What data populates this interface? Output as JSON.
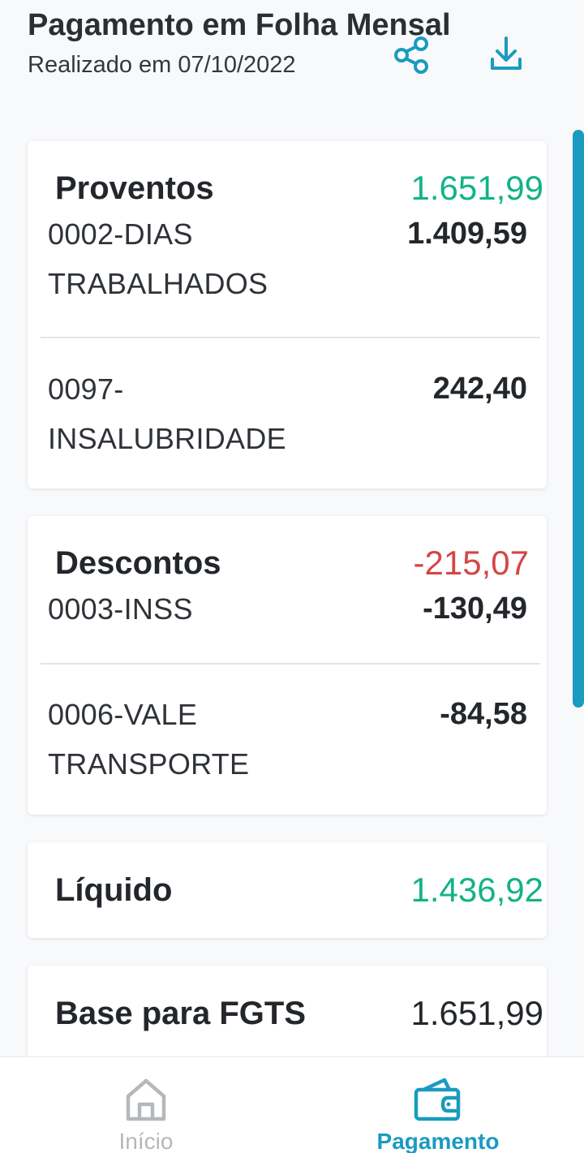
{
  "header": {
    "title": "Pagamento em Folha Mensal",
    "subtitle": "Realizado em 07/10/2022",
    "share_icon": "share-icon",
    "download_icon": "download-icon"
  },
  "colors": {
    "accent": "#1a9bbf",
    "positive": "#12b386",
    "negative": "#d64545"
  },
  "proventos": {
    "title": "Proventos",
    "total": "1.651,99",
    "items": [
      {
        "label": "0002-DIAS TRABALHADOS",
        "value": "1.409,59"
      },
      {
        "label": "0097-INSALUBRIDADE",
        "value": "242,40"
      }
    ]
  },
  "descontos": {
    "title": "Descontos",
    "total": "-215,07",
    "items": [
      {
        "label": "0003-INSS",
        "value": "-130,49"
      },
      {
        "label": "0006-VALE TRANSPORTE",
        "value": "-84,58"
      }
    ]
  },
  "liquido": {
    "title": "Líquido",
    "value": "1.436,92"
  },
  "fgts": {
    "title": "Base para FGTS",
    "value": "1.651,99"
  },
  "bottom_nav": {
    "items": [
      {
        "label": "Início",
        "icon": "home-icon",
        "active": false
      },
      {
        "label": "Pagamento",
        "icon": "wallet-icon",
        "active": true
      }
    ]
  }
}
